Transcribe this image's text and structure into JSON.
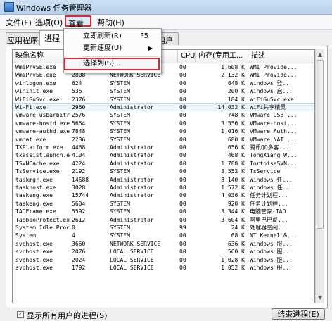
{
  "window": {
    "title": "Windows 任务管理器"
  },
  "menu": {
    "file": "文件(F)",
    "options": "选项(O)",
    "view": "查看(V)",
    "help": "帮助(H)"
  },
  "tabs": [
    "应用程序",
    "进程",
    "",
    "用户"
  ],
  "dropdown": {
    "refresh": "立即刷新(R)",
    "refresh_shortcut": "F5",
    "speed": "更新速度(U)",
    "submenu_arrow": "▶",
    "select_columns": "选择列(S)..."
  },
  "columns": [
    "映像名称",
    "",
    "",
    "CPU",
    "内存(专用工...",
    "描述"
  ],
  "processes": [
    [
      "WmiPrvSE.exe",
      "",
      "",
      "00",
      "1,608 K",
      "WMI Provide..."
    ],
    [
      "WmiPrvSE.exe",
      "2808",
      "NETWORK SERVICE",
      "00",
      "2,132 K",
      "WMI Provide..."
    ],
    [
      "winlogon.exe",
      "624",
      "SYSTEM",
      "00",
      "648 K",
      "Windows 登..."
    ],
    [
      "wininit.exe",
      "536",
      "SYSTEM",
      "00",
      "200 K",
      "Windows 启..."
    ],
    [
      "WiFiGuSvc.exe",
      "2376",
      "SYSTEM",
      "00",
      "184 K",
      "WiFiGuSvc.exe"
    ],
    [
      "Wi-Fi.exe",
      "2960",
      "Administrator",
      "00",
      "14,032 K",
      "WiFi共享精灵"
    ],
    [
      "vmware-usbarbitr...",
      "2576",
      "SYSTEM",
      "00",
      "748 K",
      "VMware USB ..."
    ],
    [
      "vmware-hostd.exe",
      "5664",
      "SYSTEM",
      "00",
      "3,556 K",
      "VMware-host..."
    ],
    [
      "vmware-authd.exe",
      "7848",
      "SYSTEM",
      "00",
      "1,016 K",
      "VMware Auth..."
    ],
    [
      "vmnat.exe",
      "2236",
      "SYSTEM",
      "00",
      "680 K",
      "VMware NAT ..."
    ],
    [
      "TXPlatform.exe",
      "4468",
      "Administrator",
      "00",
      "656 K",
      "腾讯QQ多客..."
    ],
    [
      "txassistlaunch.exe",
      "4104",
      "Administrator",
      "00",
      "468 K",
      "TongXiang W..."
    ],
    [
      "TSVNCache.exe",
      "4224",
      "Administrator",
      "00",
      "1,788 K",
      "TortoiseSVN..."
    ],
    [
      "TsService.exe",
      "2192",
      "SYSTEM",
      "00",
      "3,552 K",
      "TsService"
    ],
    [
      "taskmgr.exe",
      "14688",
      "Administrator",
      "00",
      "8,140 K",
      "Windows 任..."
    ],
    [
      "taskhost.exe",
      "3028",
      "Administrator",
      "00",
      "1,572 K",
      "Windows 任..."
    ],
    [
      "taskeng.exe",
      "15744",
      "Administrator",
      "00",
      "4,036 K",
      "任务计划程..."
    ],
    [
      "taskeng.exe",
      "5604",
      "SYSTEM",
      "00",
      "920 K",
      "任务计划程..."
    ],
    [
      "TAOFrame.exe",
      "5592",
      "SYSTEM",
      "00",
      "3,344 K",
      "电脑管家-TAO"
    ],
    [
      "TaobaoProtect.exe",
      "2612",
      "Administrator",
      "00",
      "3,604 K",
      "阿里巴巴反..."
    ],
    [
      "System Idle Process",
      "0",
      "SYSTEM",
      "99",
      "24 K",
      "处理器空闲..."
    ],
    [
      "System",
      "4",
      "SYSTEM",
      "00",
      "68 K",
      "NT Kernel &..."
    ],
    [
      "svchost.exe",
      "3660",
      "NETWORK SERVICE",
      "00",
      "636 K",
      "Windows 服..."
    ],
    [
      "svchost.exe",
      "2076",
      "LOCAL SERVICE",
      "00",
      "560 K",
      "Windows 服..."
    ],
    [
      "svchost.exe",
      "2024",
      "LOCAL SERVICE",
      "00",
      "1,028 K",
      "Windows 服..."
    ],
    [
      "svchost.exe",
      "1792",
      "LOCAL SERVICE",
      "00",
      "1,052 K",
      "Windows 服..."
    ]
  ],
  "selected_index": 5,
  "footer": {
    "show_all_users": "显示所有用户的进程(S)",
    "end_process": "结束进程(E)"
  },
  "colors": {
    "highlight_border": "#e1262f"
  }
}
